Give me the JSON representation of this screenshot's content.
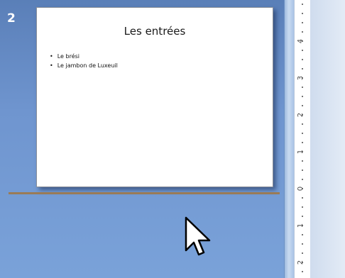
{
  "slides_pane": {
    "slide_number": "2",
    "slide": {
      "title": "Les entrées",
      "bullets": [
        "Le brési",
        "Le jambon de Luxeuil"
      ]
    }
  },
  "ruler": {
    "labels": [
      "4",
      "3",
      "2",
      "1",
      "0",
      "1",
      "2"
    ]
  },
  "colors": {
    "pane_background": "#6f95cf",
    "insert_marker": "#9a7b56",
    "slide_background": "#ffffff"
  },
  "icons": {
    "cursor": "mouse-pointer-icon"
  }
}
